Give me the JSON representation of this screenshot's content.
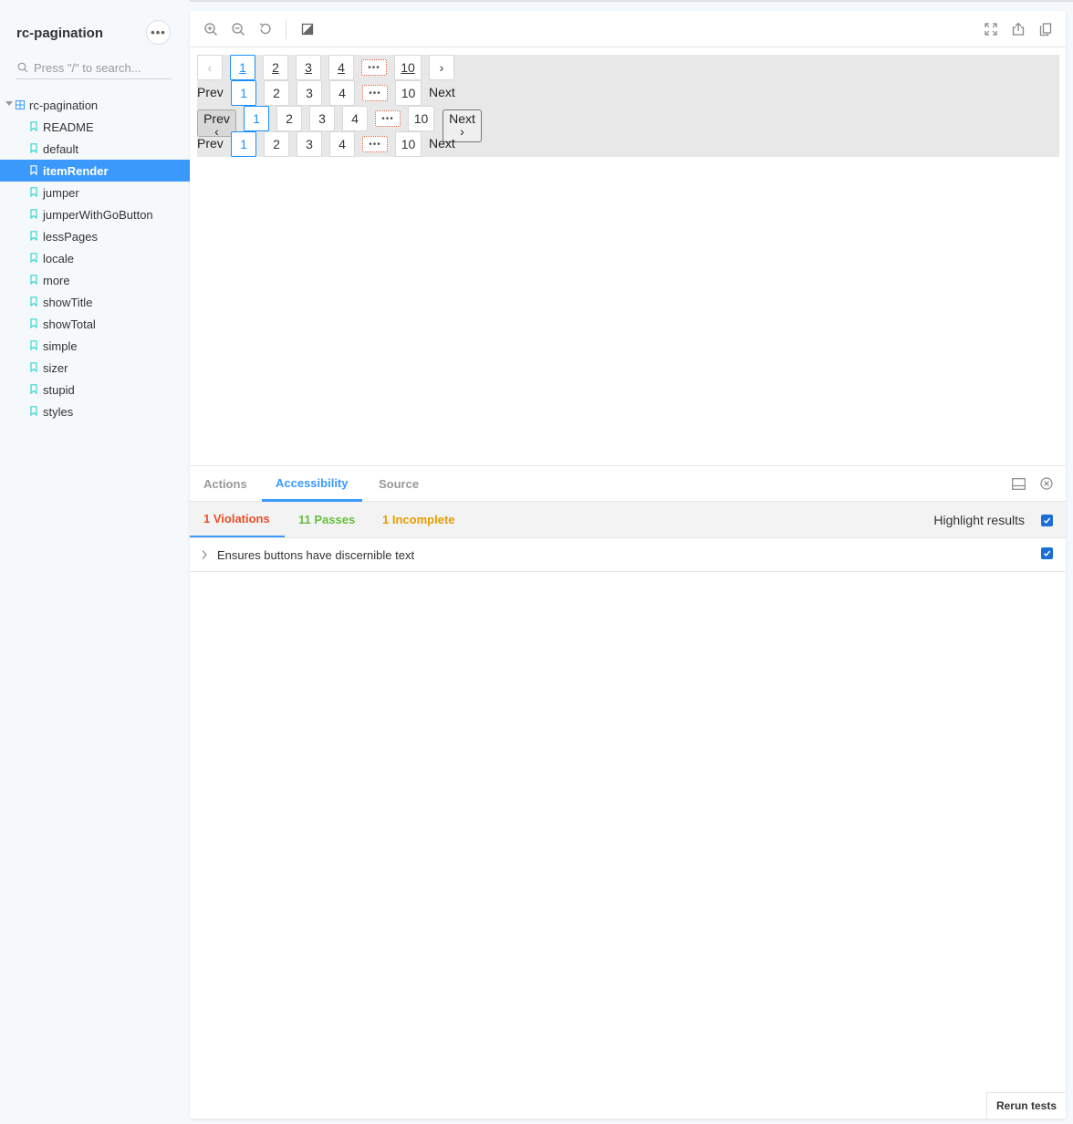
{
  "sidebar": {
    "title": "rc-pagination",
    "search_placeholder": "Press \"/\" to search...",
    "root_label": "rc-pagination",
    "stories": [
      "README",
      "default",
      "itemRender",
      "jumper",
      "jumperWithGoButton",
      "lessPages",
      "locale",
      "more",
      "showTitle",
      "showTotal",
      "simple",
      "sizer",
      "stupid",
      "styles"
    ],
    "active_story": "itemRender"
  },
  "preview": {
    "row1": {
      "prev": "‹",
      "pages": [
        "1",
        "2",
        "3",
        "4",
        "10"
      ],
      "more": "•••",
      "next": "›"
    },
    "row2": {
      "prev": "Prev",
      "pages": [
        "1",
        "2",
        "3",
        "4",
        "10"
      ],
      "more": "•••",
      "next": "Next"
    },
    "row3": {
      "prev_line1": "Prev",
      "prev_line2": "‹",
      "pages": [
        "1",
        "2",
        "3",
        "4",
        "10"
      ],
      "more": "•••",
      "next_line1": "Next",
      "next_line2": "›"
    },
    "row4": {
      "prev": "Prev",
      "pages": [
        "1",
        "2",
        "3",
        "4",
        "10"
      ],
      "more": "•••",
      "next": "Next"
    },
    "current_page": "1"
  },
  "addons": {
    "tabs": [
      "Actions",
      "Accessibility",
      "Source"
    ],
    "active_tab": "Accessibility",
    "results": {
      "violations": "1 Violations",
      "passes": "11 Passes",
      "incomplete": "1 Incomplete"
    },
    "highlight_label": "Highlight results",
    "rule": "Ensures buttons have discernible text",
    "rerun_label": "Rerun tests"
  },
  "colors": {
    "accent": "#3b99fc",
    "violation": "#e8502b",
    "pass": "#66bf3c",
    "incomplete": "#e69d00"
  }
}
